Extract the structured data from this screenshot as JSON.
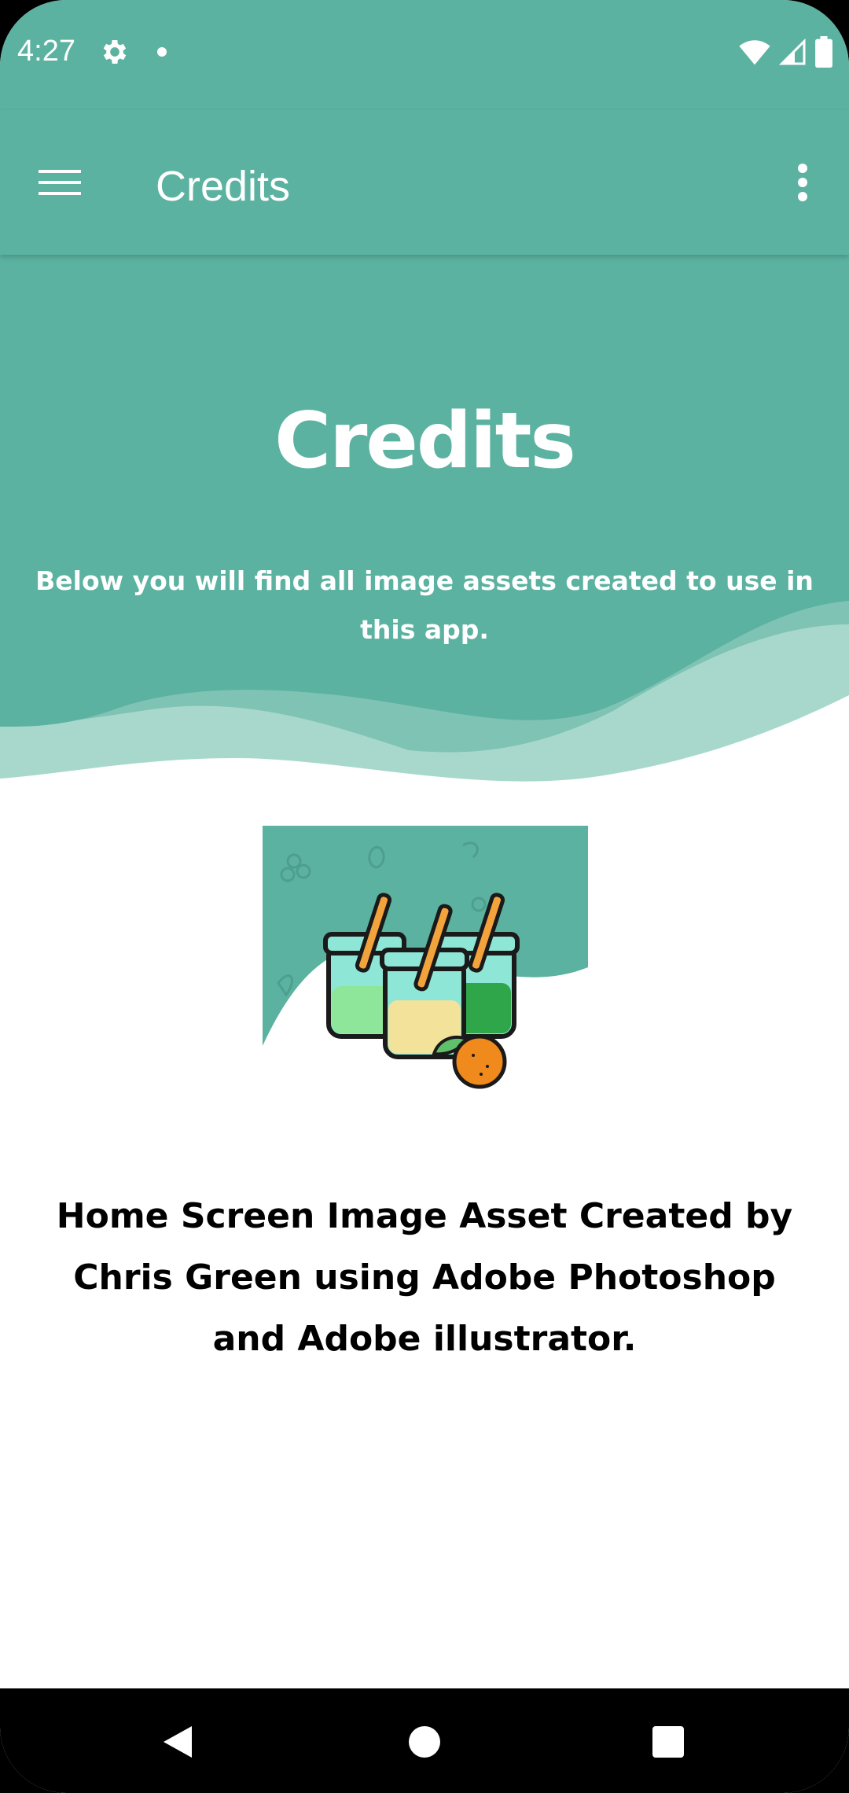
{
  "status_bar": {
    "time": "4:27",
    "icons": [
      "gear-icon",
      "notification-dot-icon",
      "wifi-icon",
      "cellular-icon",
      "battery-icon"
    ]
  },
  "app_bar": {
    "title": "Credits",
    "menu_icon": "hamburger-menu-icon",
    "overflow_icon": "more-vert-icon"
  },
  "hero": {
    "title": "Credits",
    "subtitle": "Below you will find all image assets created to use in this app."
  },
  "credit": {
    "image_name": "smoothie-jars-illustration",
    "text": "Home Screen Image Asset Created by Chris Green using Adobe Photoshop and Adobe illustrator."
  },
  "nav_bar": {
    "icons": [
      "back-icon",
      "home-icon",
      "recents-icon"
    ]
  },
  "colors": {
    "primary": "#5bb2a0",
    "wave_light": "#a8d8cc",
    "text_dark": "#000000",
    "orange": "#f08a1c"
  }
}
